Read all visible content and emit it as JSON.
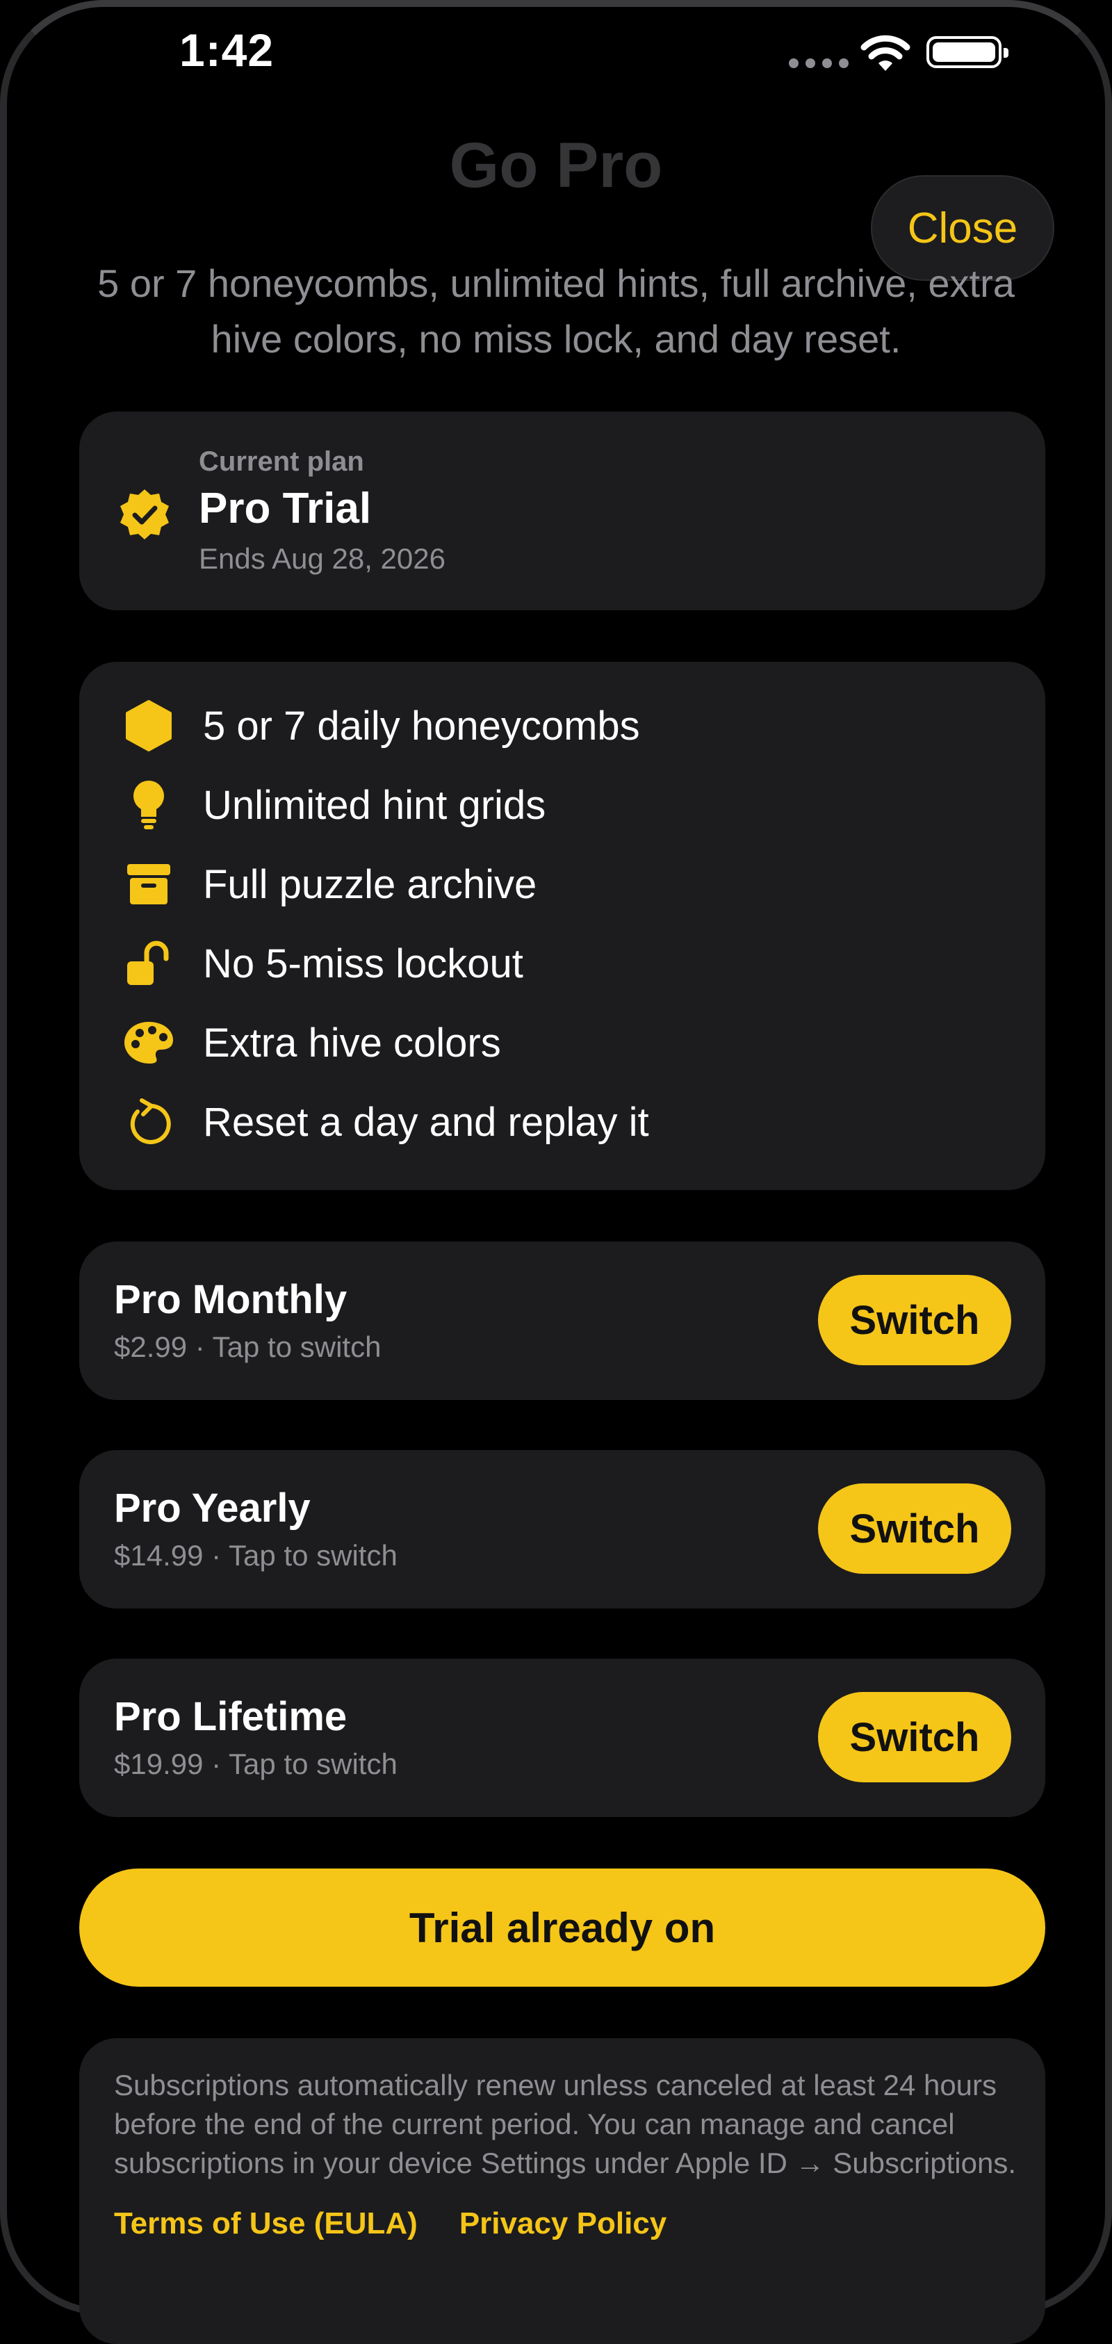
{
  "status_bar": {
    "time": "1:42"
  },
  "header": {
    "title": "Go Pro",
    "close_label": "Close",
    "subtitle": "5 or 7 honeycombs, unlimited hints, full archive, extra hive colors, no miss lock, and day reset."
  },
  "current_plan": {
    "label": "Current plan",
    "name": "Pro Trial",
    "ends": "Ends Aug 28, 2026",
    "icon": "checkmark-seal-icon"
  },
  "features": [
    {
      "icon": "hexagon-icon",
      "label": "5 or 7 daily honeycombs"
    },
    {
      "icon": "lightbulb-icon",
      "label": "Unlimited hint grids"
    },
    {
      "icon": "archive-box-icon",
      "label": "Full puzzle archive"
    },
    {
      "icon": "unlocked-lock-icon",
      "label": "No 5-miss lockout"
    },
    {
      "icon": "palette-icon",
      "label": "Extra hive colors"
    },
    {
      "icon": "reset-arrow-icon",
      "label": "Reset a day and replay it"
    }
  ],
  "options": [
    {
      "name": "Pro Monthly",
      "price": "$2.99 · Tap to switch",
      "button": "Switch"
    },
    {
      "name": "Pro Yearly",
      "price": "$14.99 · Tap to switch",
      "button": "Switch"
    },
    {
      "name": "Pro Lifetime",
      "price": "$19.99 · Tap to switch",
      "button": "Switch"
    }
  ],
  "primary_button": "Trial already on",
  "legal": {
    "text": "Subscriptions automatically renew unless canceled at least 24 hours before the end of the current period. You can manage and cancel subscriptions in your device Settings under Apple ID → Subscriptions.",
    "terms_link": "Terms of Use (EULA)",
    "privacy_link": "Privacy Policy"
  },
  "colors": {
    "accent": "#f5c518",
    "background": "#000000",
    "card": "#1c1c1e",
    "secondary_text": "#8e8e93"
  }
}
